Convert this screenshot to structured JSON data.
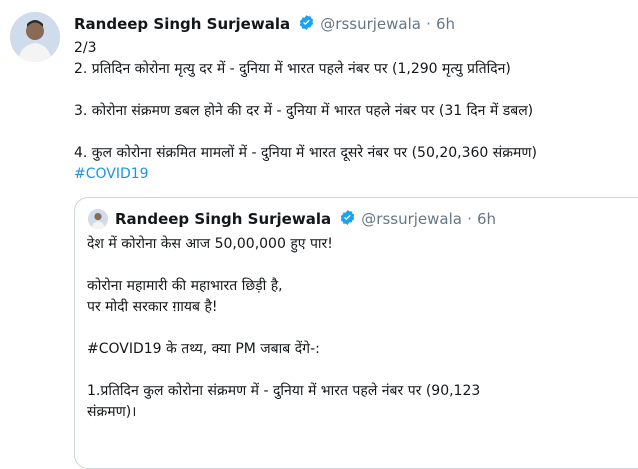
{
  "tweet": {
    "author_name": "Randeep Singh Surjewala",
    "handle": "@rssurjewala",
    "separator": "·",
    "time": "6h",
    "lines": [
      "2/3",
      "2. प्रतिदिन कोरोना मृत्यु दर में - दुनिया में भारत पहले नंबर पर (1,290 मृत्यु प्रतिदिन)",
      "",
      "3. कोरोना संक्रमण डबल होने की दर में - दुनिया में भारत पहले नंबर पर (31 दिन में डबल)",
      "",
      "4. कुल कोरोना संक्रमित मामलों में - दुनिया में भारत दूसरे नंबर पर (50,20,360 संक्रमण)"
    ],
    "hashtag": "#COVID19"
  },
  "quoted_tweet": {
    "author_name": "Randeep Singh Surjewala",
    "handle": "@rssurjewala",
    "separator": "·",
    "time": "6h",
    "lines": [
      "देश में कोरोना केस आज 50,00,000 हुए पार!",
      "",
      "कोरोना महामारी की महाभारत छिड़ी है,",
      "पर मोदी सरकार ग़ायब है!",
      "",
      "#COVID19 के तथ्य, क्या PM जबाब देंगे-:",
      "",
      "1.प्रतिदिन कुल कोरोना संक्रमण में - दुनिया में भारत पहले नंबर पर (90,123",
      "संक्रमण)।"
    ]
  },
  "colors": {
    "verified": "#1da1f2",
    "link": "#1b95e0",
    "secondary": "#657786",
    "border": "#ccd6dd"
  },
  "icons": {
    "verified": "verified-badge-icon"
  }
}
